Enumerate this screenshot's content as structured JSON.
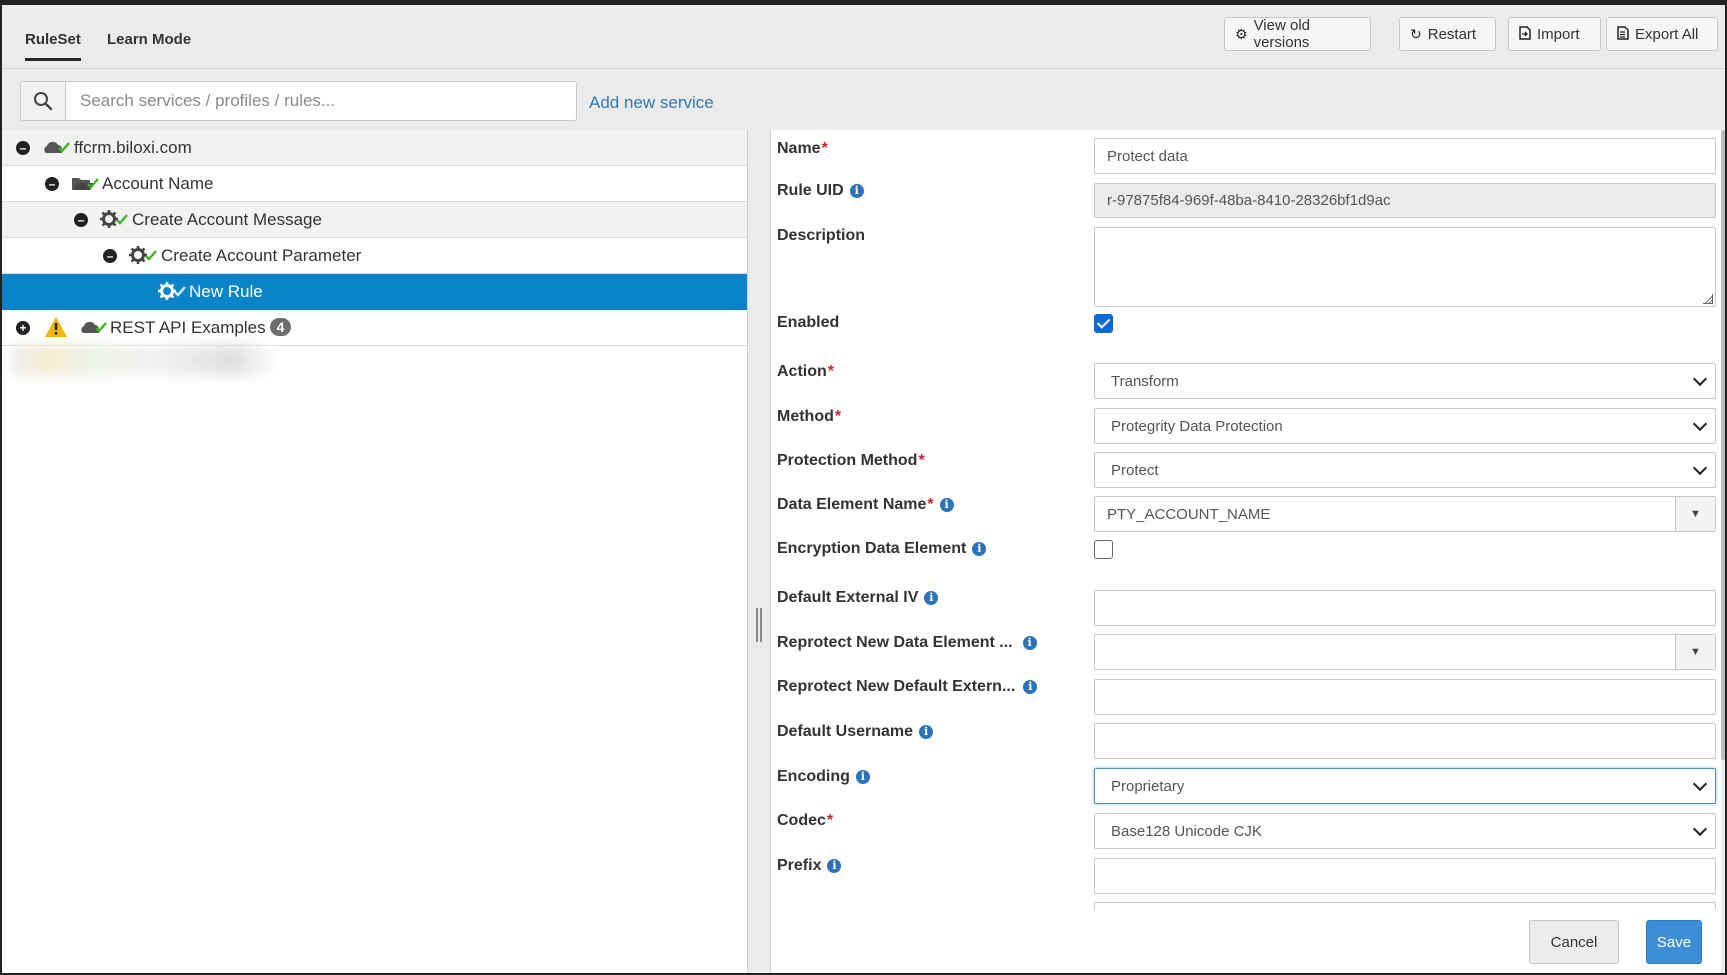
{
  "tabs": [
    {
      "label": "RuleSet",
      "active": true
    },
    {
      "label": "Learn Mode",
      "active": false
    }
  ],
  "toolbar": {
    "view_old_versions": "View old versions",
    "restart": "Restart",
    "import": "Import",
    "export_all": "Export All"
  },
  "search": {
    "placeholder": "Search services / profiles / rules...",
    "value": "",
    "add_service": "Add new service"
  },
  "tree": {
    "items": [
      {
        "label": "ffcrm.biloxi.com",
        "icon": "cloud-icon",
        "status": "check",
        "expanded": true
      },
      {
        "label": "Account Name",
        "icon": "folder-open-icon",
        "status": "check",
        "expanded": true
      },
      {
        "label": "Create Account Message",
        "icon": "gear-icon",
        "status": "check",
        "expanded": true
      },
      {
        "label": "Create Account Parameter",
        "icon": "gear-icon",
        "status": "check",
        "expanded": true
      },
      {
        "label": "New Rule",
        "icon": "gear-icon",
        "status": "check",
        "selected": true
      },
      {
        "label": "REST API Examples",
        "icon": "cloud-icon",
        "status": "warning",
        "expanded": false,
        "badge": "4"
      }
    ]
  },
  "form": {
    "name": {
      "label": "Name",
      "required": true,
      "value": "Protect data"
    },
    "rule_uid": {
      "label": "Rule UID",
      "value": "r-97875f84-969f-48ba-8410-28326bf1d9ac"
    },
    "description": {
      "label": "Description",
      "value": ""
    },
    "enabled": {
      "label": "Enabled",
      "checked": true
    },
    "action": {
      "label": "Action",
      "required": true,
      "value": "Transform"
    },
    "method": {
      "label": "Method",
      "required": true,
      "value": "Protegrity Data Protection"
    },
    "protection_method": {
      "label": "Protection Method",
      "required": true,
      "value": "Protect"
    },
    "data_element_name": {
      "label": "Data Element Name",
      "required": true,
      "value": "PTY_ACCOUNT_NAME"
    },
    "encryption_data_element": {
      "label": "Encryption Data Element",
      "checked": false
    },
    "default_external_iv": {
      "label": "Default External IV",
      "value": ""
    },
    "reprotect_new_data_element": {
      "label": "Reprotect New Data Element ...",
      "value": ""
    },
    "reprotect_new_default_extern": {
      "label": "Reprotect New Default Extern...",
      "value": ""
    },
    "default_username": {
      "label": "Default Username",
      "value": ""
    },
    "encoding": {
      "label": "Encoding",
      "value": "Proprietary"
    },
    "codec": {
      "label": "Codec",
      "required": true,
      "value": "Base128 Unicode CJK"
    },
    "prefix": {
      "label": "Prefix",
      "value": ""
    },
    "required_mark": "*"
  },
  "footer": {
    "cancel": "Cancel",
    "save": "Save"
  },
  "colors": {
    "selection": "#0a84c8",
    "required": "#c8262c",
    "info": "#2e72b8",
    "check": "#3cb521",
    "warning": "#f0b400",
    "save_button": "#3d8ed6"
  }
}
